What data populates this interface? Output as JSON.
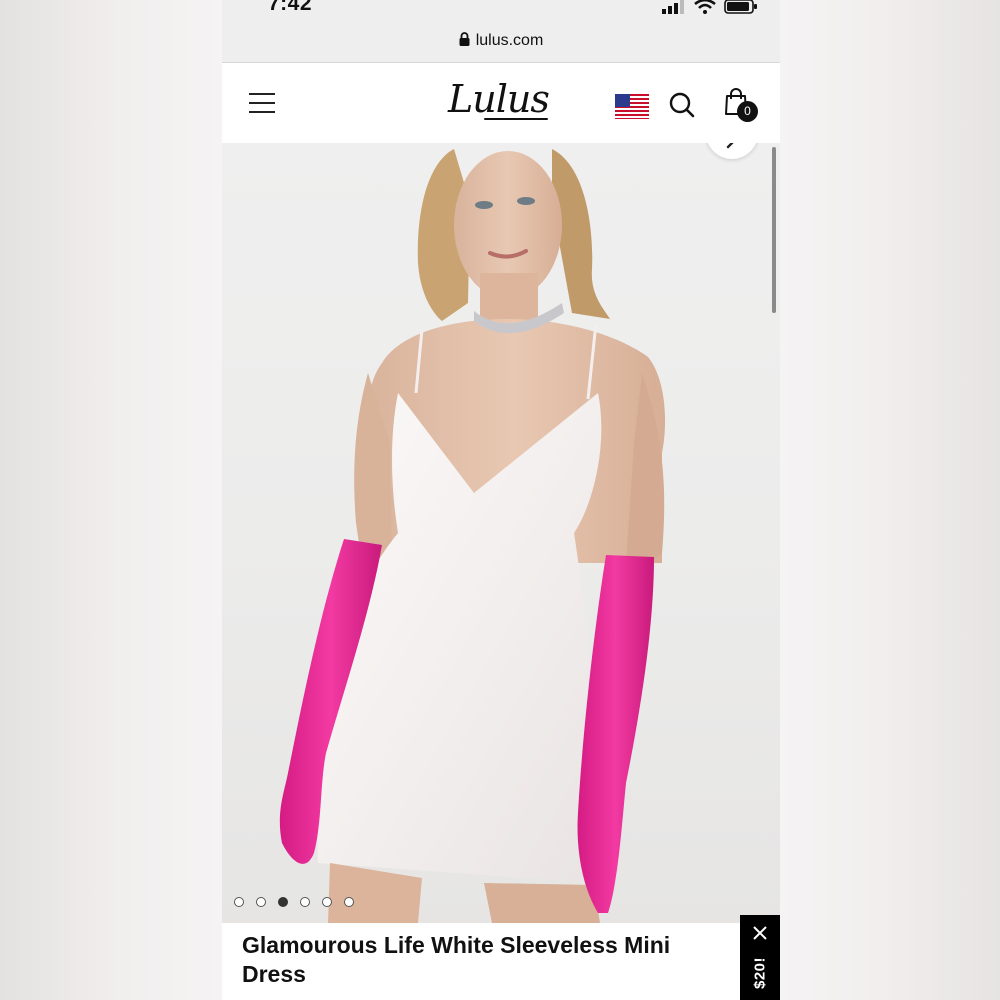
{
  "status_bar": {
    "time": "7:42"
  },
  "browser": {
    "url": "lulus.com"
  },
  "header": {
    "logo": "Lulus",
    "cart_count": "0"
  },
  "gallery": {
    "image_count": 6,
    "active_index": 2
  },
  "product": {
    "title": "Glamourous Life White Sleeveless Mini Dress"
  },
  "promo": {
    "label": "$20!"
  },
  "colors": {
    "glove_pink": "#ea2f97",
    "dress_white": "#f6f3f2",
    "promo_bg": "#000000"
  }
}
